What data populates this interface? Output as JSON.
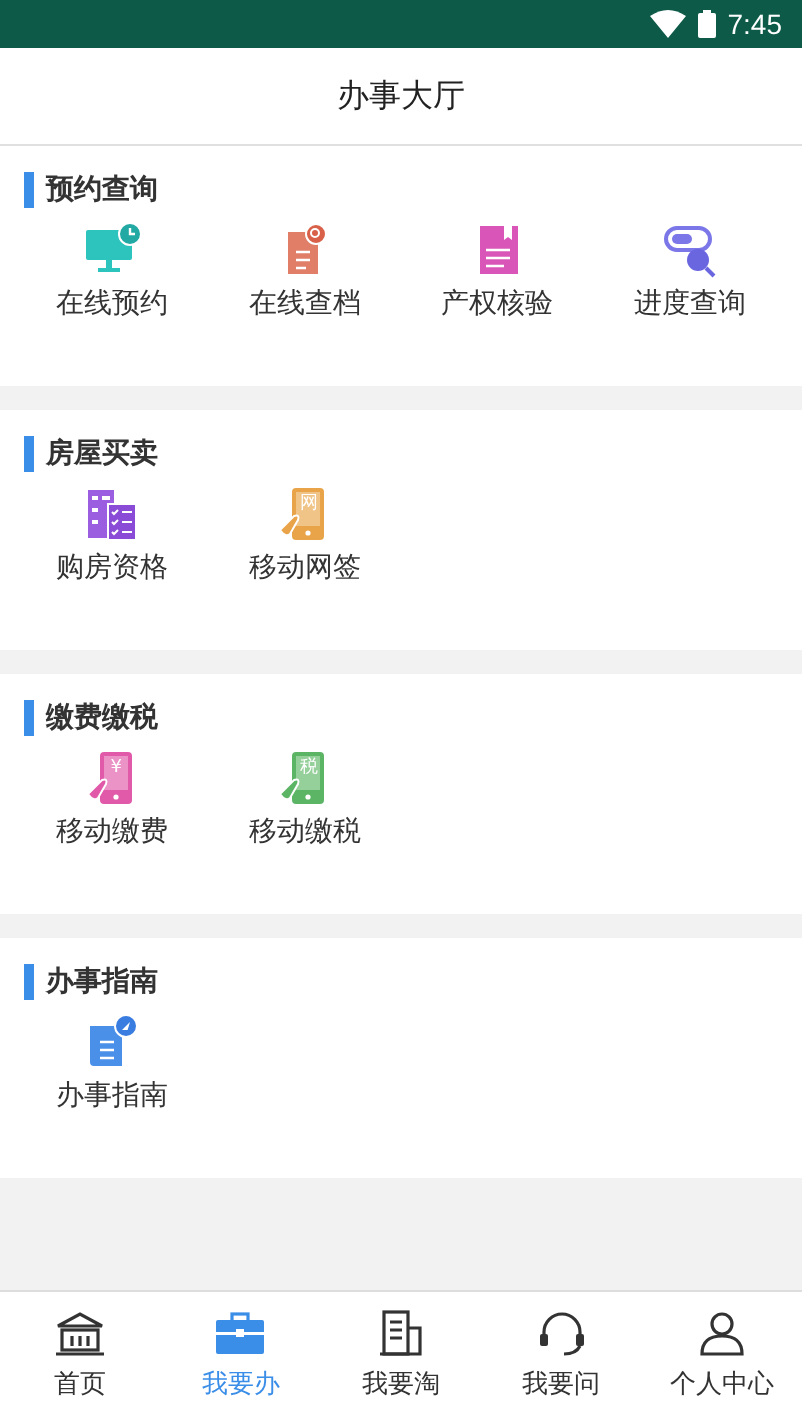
{
  "status_bar": {
    "time": "7:45"
  },
  "header": {
    "title": "办事大厅"
  },
  "sections": [
    {
      "title": "预约查询",
      "items": [
        {
          "label": "在线预约"
        },
        {
          "label": "在线查档"
        },
        {
          "label": "产权核验"
        },
        {
          "label": "进度查询"
        }
      ]
    },
    {
      "title": "房屋买卖",
      "items": [
        {
          "label": "购房资格"
        },
        {
          "label": "移动网签",
          "glyph": "网"
        }
      ]
    },
    {
      "title": "缴费缴税",
      "items": [
        {
          "label": "移动缴费",
          "glyph": "¥"
        },
        {
          "label": "移动缴税",
          "glyph": "税"
        }
      ]
    },
    {
      "title": "办事指南",
      "items": [
        {
          "label": "办事指南"
        }
      ]
    }
  ],
  "tab_bar": [
    {
      "label": "首页",
      "selected": false
    },
    {
      "label": "我要办",
      "selected": true
    },
    {
      "label": "我要淘",
      "selected": false
    },
    {
      "label": "我要问",
      "selected": false
    },
    {
      "label": "个人中心",
      "selected": false
    }
  ]
}
